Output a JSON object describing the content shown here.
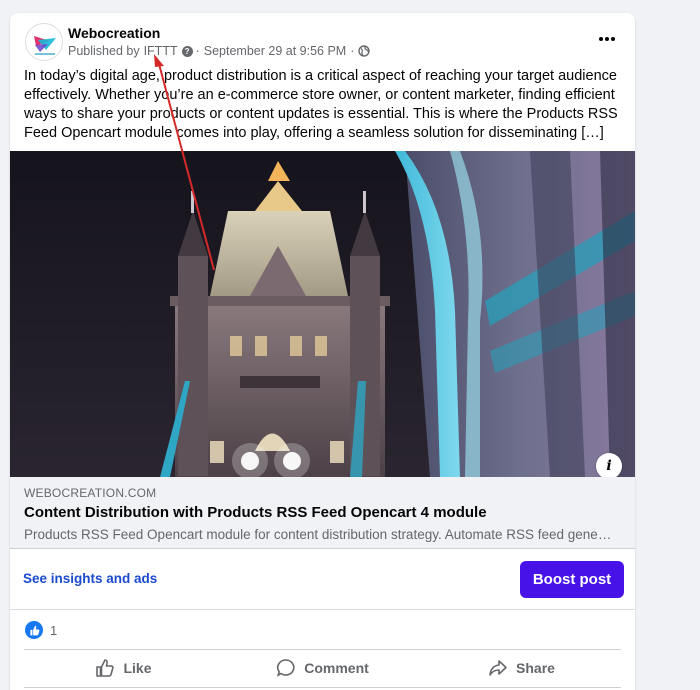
{
  "post": {
    "page_name": "Webocreation",
    "published_by_prefix": "Published by",
    "publisher": "IFTTT",
    "date": "September 29 at 9:56 PM",
    "separator": "·",
    "body": "In today’s digital age, product distribution is a critical aspect of reaching your target audience effectively. Whether you’re an e-commerce store owner, or content marketer, finding efficient ways to share your products or content updates is essential. This is where the Products RSS Feed Opencart module comes into play, offering a seamless solution for disseminating […]"
  },
  "link_preview": {
    "domain": "WEBOCREATION.COM",
    "title": "Content Distribution with Products RSS Feed Opencart 4 module",
    "description": "Products RSS Feed Opencart module for content distribution strategy. Automate RSS feed generation"
  },
  "insights": {
    "link_label": "See insights and ads",
    "boost_label": "Boost post"
  },
  "reactions": {
    "count": "1"
  },
  "actions": {
    "like": "Like",
    "comment": "Comment",
    "share": "Share"
  },
  "icons": {
    "more": "more-options-icon",
    "privacy": "globe-icon",
    "help": "question-icon",
    "info": "info-icon",
    "like": "thumbs-up-icon",
    "comment": "comment-bubble-icon",
    "share": "share-arrow-icon"
  },
  "colors": {
    "boost": "#4712e8",
    "insights_link": "#1b4bcd",
    "like_badge": "#1877f2",
    "annotation_arrow": "#d42a2a"
  }
}
